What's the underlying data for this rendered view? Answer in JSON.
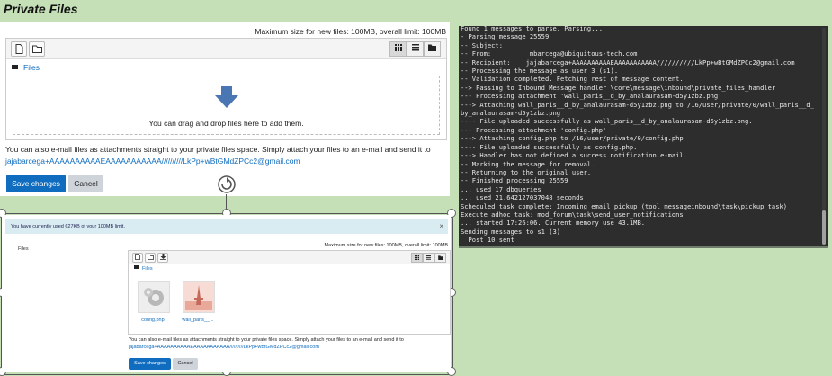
{
  "page_title": "Private Files",
  "panel1": {
    "max_size_text": "Maximum size for new files: 100MB, overall limit: 100MB",
    "breadcrumb": "Files",
    "drop_text": "You can drag and drop files here to add them.",
    "email_text": "You can also e-mail files as attachments straight to your private files space. Simply attach your files to an e-mail and send it to",
    "email_address": "jajabarcega+AAAAAAAAAAEAAAAAAAAAAA//////////LkPp+wBtGMdZPCc2@gmail.com",
    "save_label": "Save changes",
    "cancel_label": "Cancel"
  },
  "panel2": {
    "usage_alert": "You have currently used 627KB of your 100MB limit.",
    "close_glyph": "×",
    "files_label": "Files",
    "max_size_text": "Maximum size for new files: 100MB, overall limit: 100MB",
    "breadcrumb": "Files",
    "files": [
      {
        "name": "config.php"
      },
      {
        "name": "wall_paris__..."
      }
    ],
    "email_text": "You can also e-mail files as attachments straight to your private files space. Simply attach your files to an e-mail and send it to",
    "email_address": "jajabarcega+AAAAAAAAAAEAAAAAAAAAAA//////////LkPp+wBtGMdZPCc2@gmail.com",
    "save_label": "Save changes",
    "cancel_label": "Cancel"
  },
  "terminal": {
    "lines": [
      "Found 1 messages to parse. Parsing...",
      "- Parsing message 25559",
      "-- Subject:",
      "-- From:          mbarcega@ubiquitous-tech.com",
      "-- Recipient:    jajabarcega+AAAAAAAAAAEAAAAAAAAAAA//////////LkPp+wBtGMdZPCc2@gmail.com",
      "-- Processing the message as user 3 (s1).",
      "-- Validation completed. Fetching rest of message content.",
      "--> Passing to Inbound Message handler \\core\\message\\inbound\\private_files_handler",
      "--- Processing attachment 'wall_paris__d_by_analaurasam-d5y1zbz.png'",
      "---> Attaching wall_paris__d_by_analaurasam-d5y1zbz.png to /16/user/private/0/wall_paris__d_",
      "by_analaurasam-d5y1zbz.png",
      "---- File uploaded successfully as wall_paris__d_by_analaurasam-d5y1zbz.png.",
      "--- Processing attachment 'config.php'",
      "---> Attaching config.php to /16/user/private/0/config.php",
      "---- File uploaded successfully as config.php.",
      "---> Handler has not defined a success notification e-mail.",
      "-- Marking the message for removal.",
      "-- Returning to the original user.",
      "-- Finished processing 25559",
      "... used 17 dbqueries",
      "... used 21.642127037048 seconds",
      "Scheduled task complete: Incoming email pickup (tool_messageinbound\\task\\pickup_task)",
      "Execute adhoc task: mod_forum\\task\\send_user_notifications",
      "... started 17:26:06. Current memory use 43.1MB.",
      "Sending messages to s1 (3)",
      "  Post 10 sent"
    ]
  }
}
